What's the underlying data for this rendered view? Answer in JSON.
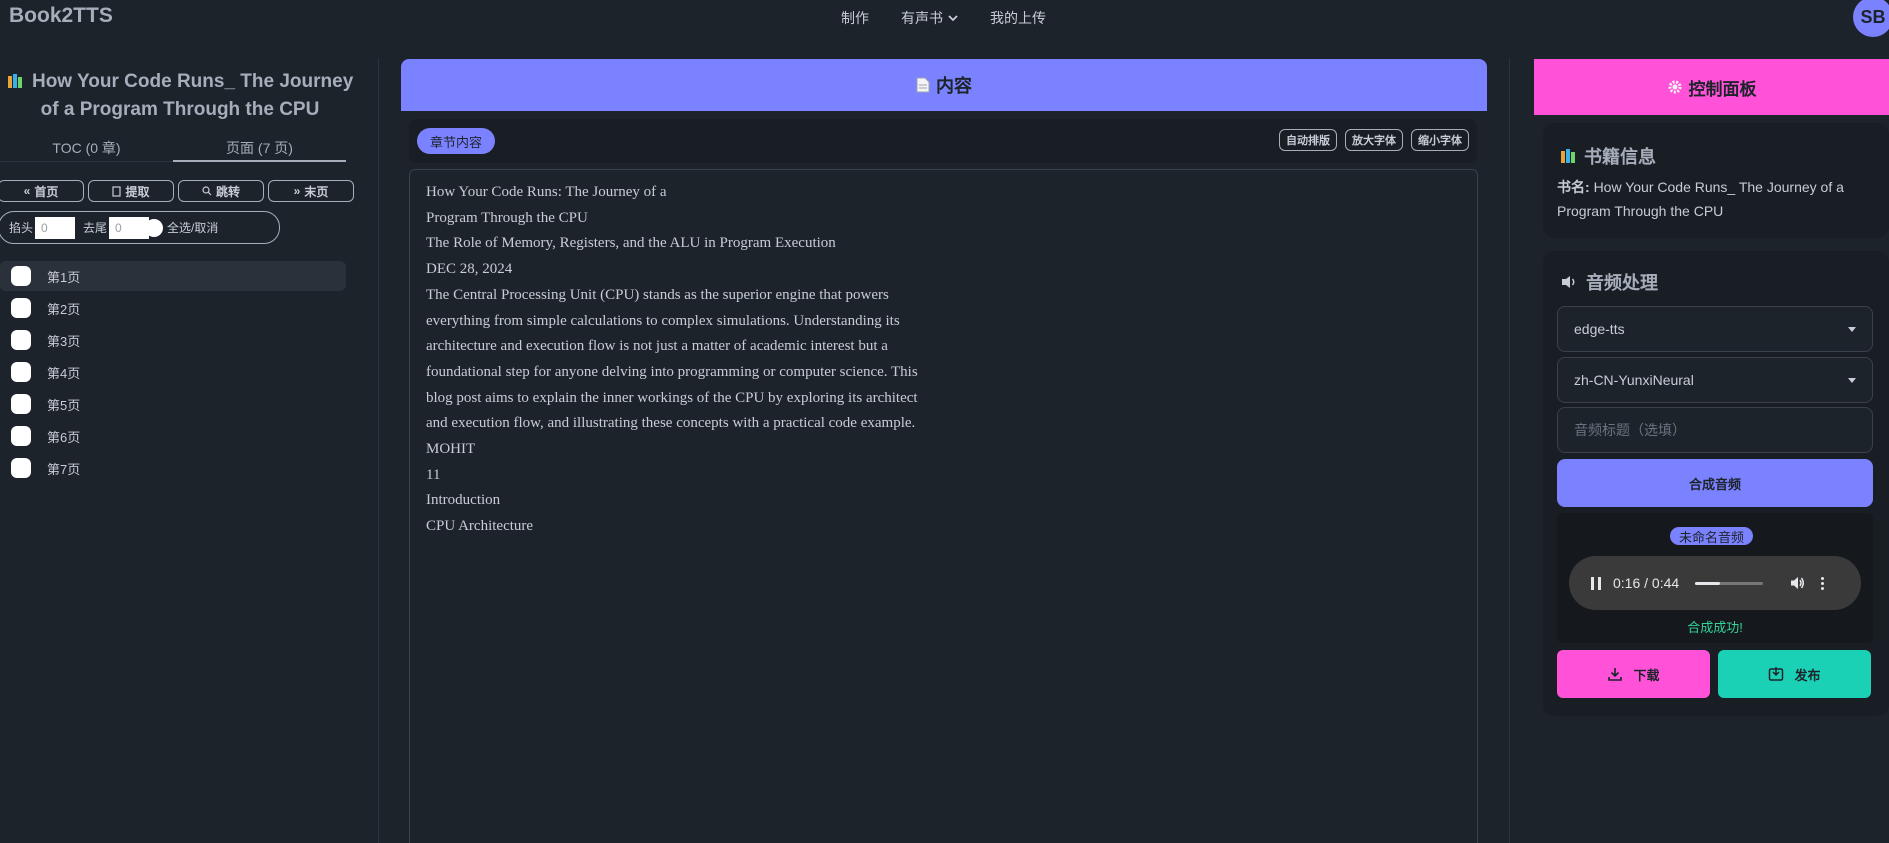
{
  "app": {
    "brand": "Book2TTS",
    "avatar_initials": "SB"
  },
  "nav": {
    "make": "制作",
    "audiobook": "有声书",
    "my_uploads": "我的上传"
  },
  "left": {
    "book_title": "How Your Code Runs_ The Journey of a Program Through the CPU",
    "tabs": [
      {
        "label": "TOC (0 章)"
      },
      {
        "label": "页面 (7 页)"
      }
    ],
    "buttons": {
      "first": "首页",
      "extract": "提取",
      "jump": "跳转",
      "last": "末页"
    },
    "trim": {
      "head_label": "掐头",
      "head_value": "0",
      "tail_label": "去尾",
      "tail_value": "0",
      "select_all": "全选/取消"
    },
    "pages": [
      "第1页",
      "第2页",
      "第3页",
      "第4页",
      "第5页",
      "第6页",
      "第7页"
    ]
  },
  "center": {
    "header": "内容",
    "chapter_badge": "章节内容",
    "tools": {
      "auto_layout": "自动排版",
      "enlarge": "放大字体",
      "shrink": "缩小字体"
    },
    "lines": [
      "How Your Code Runs: The Journey of a",
      "Program Through the CPU",
      "The Role of Memory, Registers, and the ALU in Program Execution",
      "DEC 28, 2024",
      "The Central Processing Unit (CPU) stands as the superior engine that powers",
      "everything from simple calculations to complex simulations. Understanding its",
      "architecture and execution flow is not just a matter of academic interest but a",
      "foundational step for anyone delving into programming or computer science. This",
      "blog post aims to explain the inner workings of the CPU by exploring its architect",
      "and execution flow, and illustrating these concepts with a practical code example.",
      "MOHIT",
      "11",
      "Introduction",
      "CPU Architecture"
    ]
  },
  "right": {
    "header": "控制面板",
    "book_info": {
      "title": "书籍信息",
      "name_label": "书名:",
      "name_value": "How Your Code Runs_ The Journey of a Program Through the CPU"
    },
    "audio": {
      "title": "音频处理",
      "engine": "edge-tts",
      "voice": "zh-CN-YunxiNeural",
      "title_placeholder": "音频标题（选填）",
      "synth_button": "合成音频",
      "audio_name": "未命名音频",
      "time": "0:16 / 0:44",
      "progress": 0.36,
      "success": "合成成功!",
      "download": "下载",
      "publish": "发布"
    }
  }
}
